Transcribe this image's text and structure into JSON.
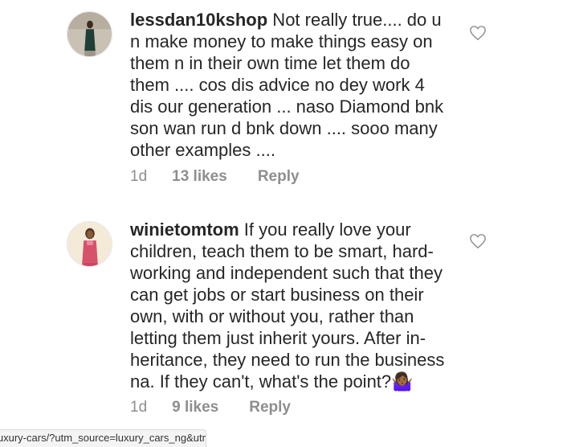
{
  "comments": [
    {
      "username": "lessdan10kshop",
      "text": " Not really true.... do u\nn make money to make things easy on\nthem n in their own time let them do\nthem .... cos dis advice no dey work 4\ndis our generation ... naso Diamond bnk\nson wan run d bnk down .... sooo many\nother examples ....",
      "time": "1d",
      "likes": "13 likes",
      "reply": "Reply"
    },
    {
      "username": "winietomtom",
      "text": " If you really love your\nchildren, teach them to be smart, hard-\nworking and independent such that they\ncan get jobs or start business on their\nown, with or without you, rather than\nletting them just inherit yours. After in-\nheritance, they need to run the business\nna. If they can't, what's the point?",
      "emoji": "🤷🏾‍♀️",
      "time": "1d",
      "likes": "9 likes",
      "reply": "Reply"
    }
  ],
  "status_url": "luxury-cars/?utm_source=luxury_cars_ng&utm_..."
}
